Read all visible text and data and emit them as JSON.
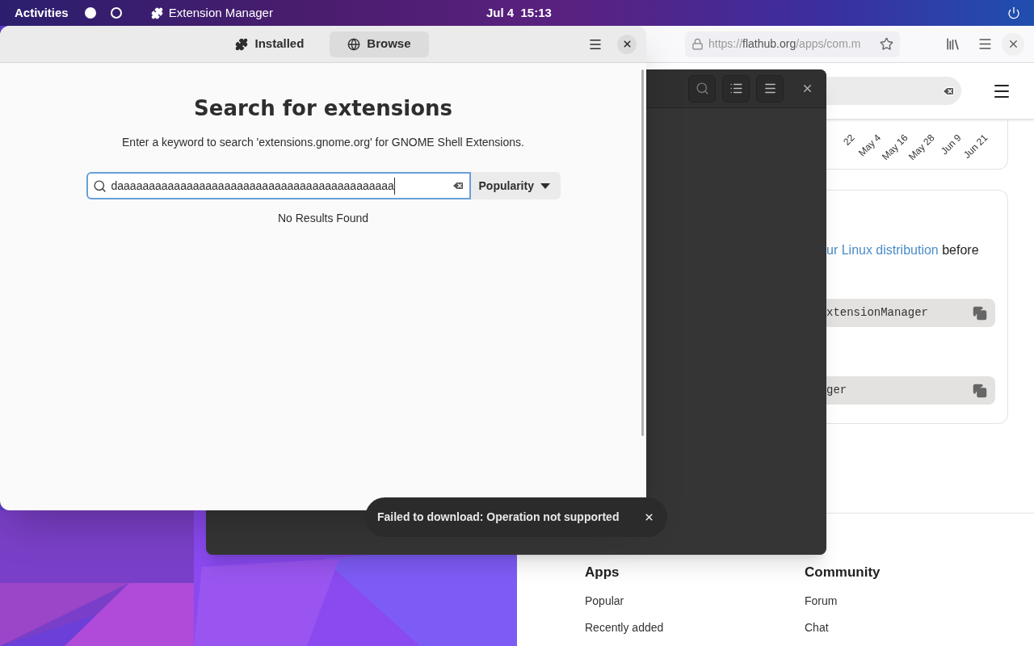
{
  "top_bar": {
    "activities": "Activities",
    "app_name": "Extension Manager",
    "clock": "Jul 4  15:13",
    "workspaces": [
      {
        "selected": true
      },
      {
        "selected": false
      }
    ]
  },
  "browser": {
    "url": {
      "scheme": "https://",
      "host": "flathub.org",
      "path": "/apps/com.m"
    },
    "chart_dates": [
      "22",
      "May 4",
      "May 16",
      "May 28",
      "Jun 9",
      "Jun 21"
    ],
    "install_text": {
      "link": "ur Linux distribution",
      "rest": " before"
    },
    "commands": [
      "xtensionManager",
      "ger"
    ],
    "footer": [
      {
        "heading": "Apps",
        "links": [
          "Popular",
          "Recently added"
        ]
      },
      {
        "heading": "Community",
        "links": [
          "Forum",
          "Chat"
        ]
      }
    ]
  },
  "extension_manager": {
    "tabs": [
      {
        "label": "Installed",
        "selected": false
      },
      {
        "label": "Browse",
        "selected": true
      }
    ],
    "heading": "Search for extensions",
    "description": "Enter a keyword to search 'extensions.gnome.org' for GNOME Shell Extensions.",
    "search": {
      "value": "daaaaaaaaaaaaaaaaaaaaaaaaaaaaaaaaaaaaaaaaaaaa"
    },
    "sort": {
      "label": "Popularity"
    },
    "status": "No Results Found"
  },
  "toast": {
    "message": "Failed to download: Operation not supported"
  }
}
